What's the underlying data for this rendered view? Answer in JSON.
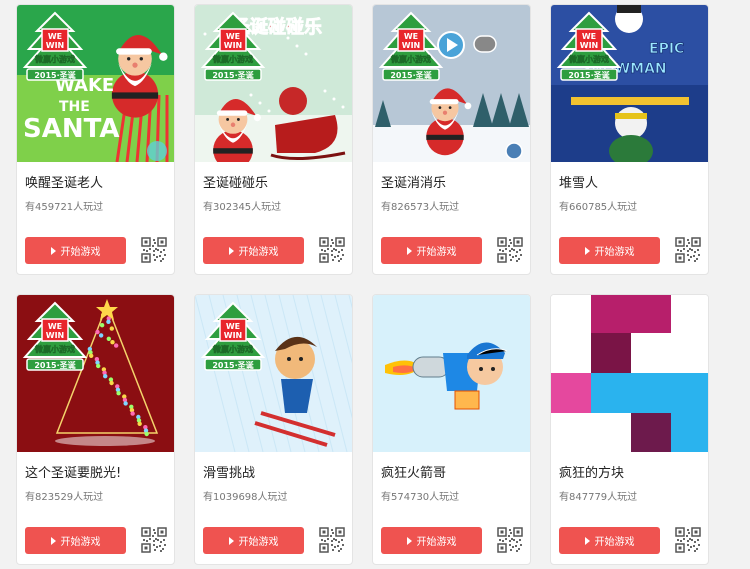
{
  "games": [
    {
      "title": "唤醒圣诞老人",
      "players": "有459721人玩过",
      "button": "开始游戏",
      "thumb_theme": "wake-the-santa",
      "thumb_text": [
        "WAKE",
        "THE",
        "SANTA"
      ],
      "badge": {
        "brand_top": "WE",
        "brand_bottom": "WIN",
        "name": "微赢小游戏",
        "year": "2015·圣诞"
      }
    },
    {
      "title": "圣诞碰碰乐",
      "players": "有302345人玩过",
      "button": "开始游戏",
      "thumb_theme": "santa-sleigh",
      "thumb_text": [
        "圣诞碰碰乐"
      ],
      "badge": {
        "brand_top": "WE",
        "brand_bottom": "WIN",
        "name": "微赢小游戏",
        "year": "2015·圣诞"
      }
    },
    {
      "title": "圣诞消消乐",
      "players": "有826573人玩过",
      "button": "开始游戏",
      "thumb_theme": "santa-snow",
      "thumb_text": [],
      "badge": {
        "brand_top": "WE",
        "brand_bottom": "WIN",
        "name": "微赢小游戏",
        "year": "2015·圣诞"
      }
    },
    {
      "title": "堆雪人",
      "players": "有660785人玩过",
      "button": "开始游戏",
      "thumb_theme": "epic-snowman",
      "thumb_text": [
        "EPIC",
        "SNOWMAN"
      ],
      "badge": {
        "brand_top": "WE",
        "brand_bottom": "WIN",
        "name": "微赢小游戏",
        "year": "2015·圣诞"
      }
    },
    {
      "title": "这个圣诞要脱光!",
      "players": "有823529人玩过",
      "button": "开始游戏",
      "thumb_theme": "xmas-tree",
      "thumb_text": [],
      "badge": {
        "brand_top": "WE",
        "brand_bottom": "WIN",
        "name": "微赢小游戏",
        "year": "2015·圣诞"
      }
    },
    {
      "title": "滑雪挑战",
      "players": "有1039698人玩过",
      "button": "开始游戏",
      "thumb_theme": "skier",
      "thumb_text": [],
      "badge": {
        "brand_top": "WE",
        "brand_bottom": "WIN",
        "name": "微赢小游戏",
        "year": "2015·圣诞"
      }
    },
    {
      "title": "疯狂火箭哥",
      "players": "有574730人玩过",
      "button": "开始游戏",
      "thumb_theme": "rocket-guy",
      "thumb_text": [],
      "badge": null
    },
    {
      "title": "疯狂的方块",
      "players": "有847779人玩过",
      "button": "开始游戏",
      "thumb_theme": "crazy-blocks",
      "thumb_text": [],
      "badge": null
    }
  ],
  "colors": {
    "button_bg": "#ef5350",
    "badge_red": "#e8262c",
    "tree_green": "#2e9e3f"
  }
}
